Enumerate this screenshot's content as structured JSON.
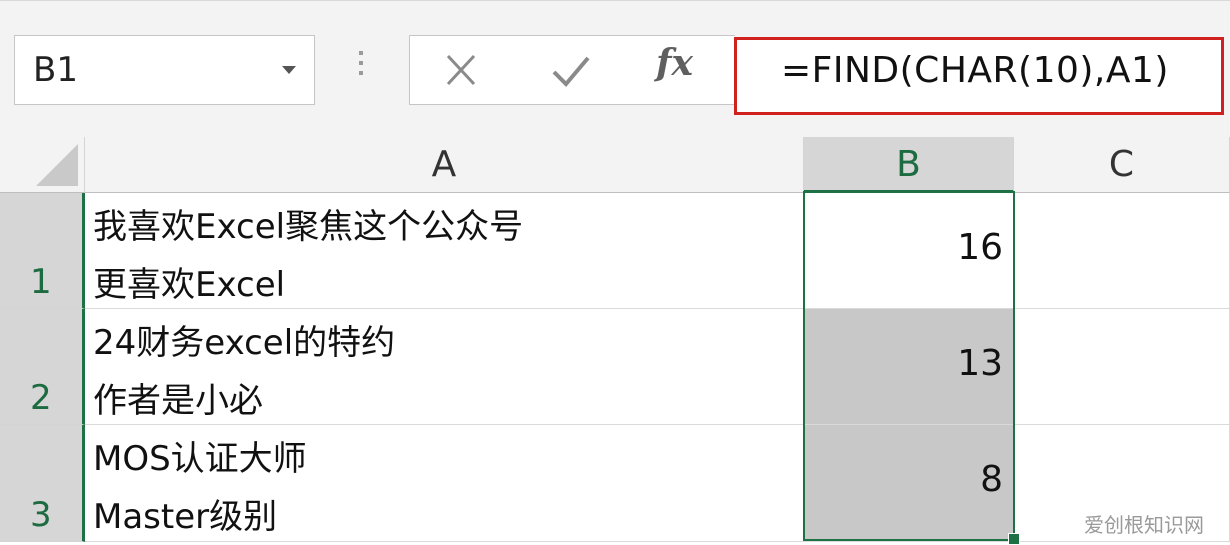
{
  "formula_bar": {
    "name_box": "B1",
    "formula": "=FIND(CHAR(10),A1)",
    "fx_label": "fx",
    "highlight_color": "#d1211f"
  },
  "columns": [
    {
      "label": "A",
      "selected": false
    },
    {
      "label": "B",
      "selected": true
    },
    {
      "label": "C",
      "selected": false
    }
  ],
  "rows": [
    {
      "number": "1",
      "a_line1": "我喜欢Excel聚焦这个公众号",
      "a_line2": "更喜欢Excel",
      "b": "16"
    },
    {
      "number": "2",
      "a_line1": "24财务excel的特约",
      "a_line2": "作者是小必",
      "b": "13"
    },
    {
      "number": "3",
      "a_line1": "MOS认证大师",
      "a_line2": "Master级别",
      "b": "8"
    }
  ],
  "watermark": "爱创根知识网",
  "colors": {
    "selection": "#1e7145",
    "shaded_cell": "#c8c8c8"
  }
}
